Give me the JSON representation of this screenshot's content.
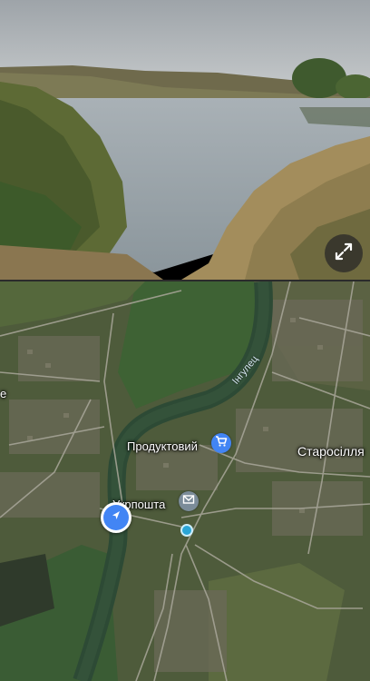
{
  "photo": {
    "expand_icon": "expand-icon"
  },
  "map": {
    "river_label": "Інгулец",
    "places": [
      {
        "name": "Продуктовий",
        "icon": "shopping-cart-icon",
        "color": "#4285f4"
      },
      {
        "name": "Укрпошта",
        "icon": "mail-icon",
        "color": "#7b8c99"
      },
      {
        "name": "Старосілля"
      },
      {
        "name": "е"
      }
    ],
    "current_location_icon": "navigation-arrow-icon"
  }
}
